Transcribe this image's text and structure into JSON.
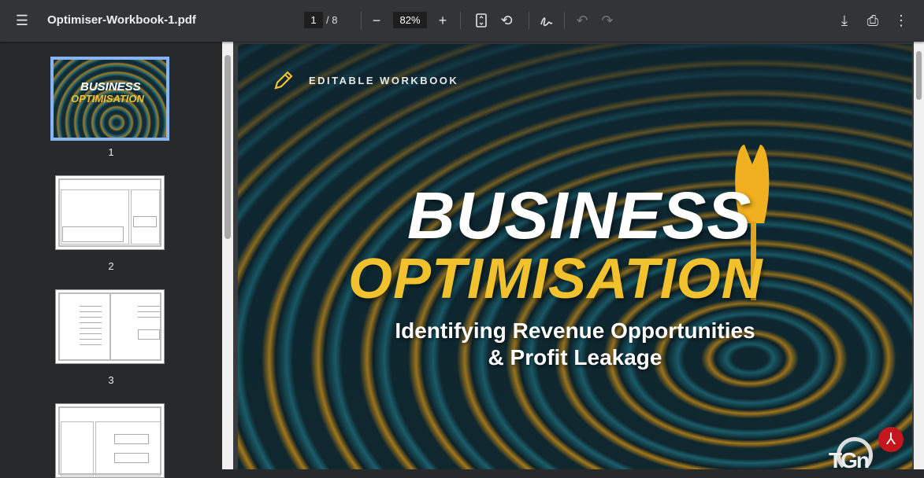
{
  "toolbar": {
    "file_name": "Optimiser-Workbook-1.pdf",
    "current_page": "1",
    "total_pages": "/ 8",
    "zoom": "82%"
  },
  "sidebar": {
    "thumbnails": [
      {
        "label": "1"
      },
      {
        "label": "2"
      },
      {
        "label": "3"
      }
    ],
    "thumb1": {
      "title1": "BUSINESS",
      "title2": "OPTIMISATION"
    }
  },
  "document": {
    "tag": "EDITABLE WORKBOOK",
    "title1": "BUSINESS",
    "title2": "OPTIMISATION",
    "subtitle1": "Identifying Revenue Opportunities",
    "subtitle2": "& Profit Leakage",
    "logo": "TGN"
  },
  "colors": {
    "accent_yellow": "#f2c12e",
    "selection": "#8ab4f8",
    "toolbar": "#333436"
  }
}
